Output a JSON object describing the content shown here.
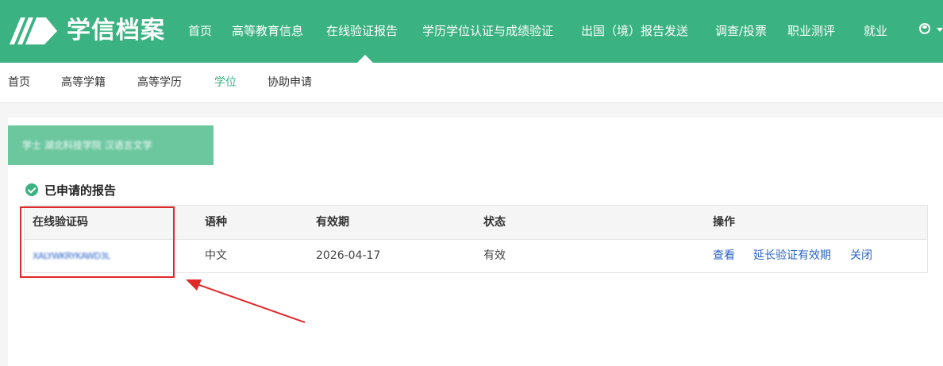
{
  "brand": {
    "title": "学信档案"
  },
  "nav": {
    "items": [
      {
        "label": "首页"
      },
      {
        "label": "高等教育信息"
      },
      {
        "label": "在线验证报告"
      },
      {
        "label": "学历学位认证与成绩验证"
      },
      {
        "label": "出国（境）报告发送"
      },
      {
        "label": "调查/投票"
      },
      {
        "label": "职业测评"
      },
      {
        "label": "就业"
      }
    ],
    "active_index": 2
  },
  "subnav": {
    "items": [
      {
        "label": "首页"
      },
      {
        "label": "高等学籍"
      },
      {
        "label": "高等学历"
      },
      {
        "label": "学位"
      },
      {
        "label": "协助申请"
      }
    ],
    "active_index": 3
  },
  "student": {
    "label": "学士 湖北科技学院 汉语言文学"
  },
  "section": {
    "title": "已申请的报告"
  },
  "table": {
    "headers": [
      "在线验证码",
      "语种",
      "有效期",
      "状态",
      "操作"
    ],
    "rows": [
      {
        "code": "XALYWKRYKAWD3L",
        "language": "中文",
        "expiry": "2026-04-17",
        "status": "有效",
        "actions": [
          "查看",
          "延长验证有效期",
          "关闭"
        ]
      }
    ]
  },
  "colors": {
    "brand_green": "#3bb281",
    "banner_green": "#6cc79f",
    "link_blue": "#2a64c6",
    "annotation_red": "#e02a2a"
  }
}
